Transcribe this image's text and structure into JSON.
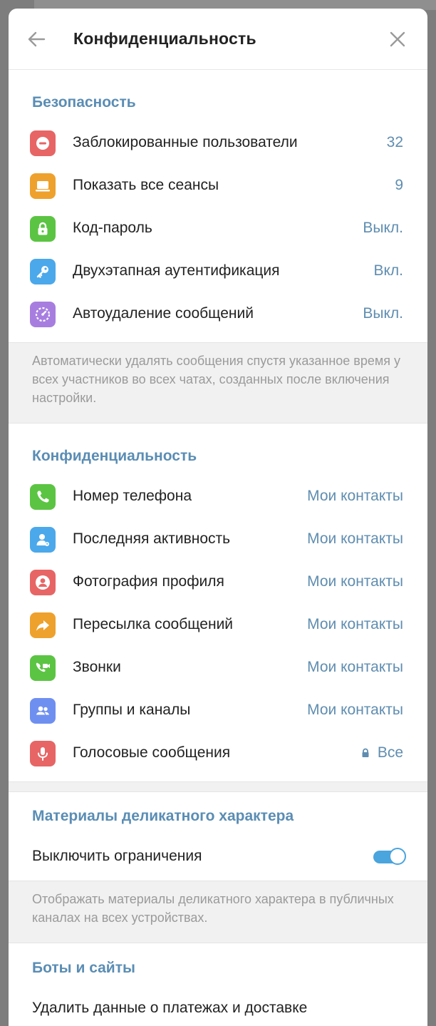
{
  "header": {
    "title": "Конфиденциальность"
  },
  "security": {
    "title": "Безопасность",
    "items": [
      {
        "label": "Заблокированные пользователи",
        "value": "32",
        "icon": "blocked-icon",
        "color": "#e76565"
      },
      {
        "label": "Показать все сеансы",
        "value": "9",
        "icon": "laptop-icon",
        "color": "#eea12c"
      },
      {
        "label": "Код-пароль",
        "value": "Выкл.",
        "icon": "lock-icon",
        "color": "#5cc443"
      },
      {
        "label": "Двухэтапная аутентификация",
        "value": "Вкл.",
        "icon": "key-icon",
        "color": "#4ba8ea"
      },
      {
        "label": "Автоудаление сообщений",
        "value": "Выкл.",
        "icon": "timer-icon",
        "color": "#a77ee0"
      }
    ],
    "hint": "Автоматически удалять сообщения спустя указанное время у всех участников во всех чатах, созданных после включения настройки."
  },
  "privacy": {
    "title": "Конфиденциальность",
    "items": [
      {
        "label": "Номер телефона",
        "value": "Мои контакты",
        "icon": "phone-icon",
        "color": "#5cc443"
      },
      {
        "label": "Последняя активность",
        "value": "Мои контакты",
        "icon": "last-seen-icon",
        "color": "#4ba8ea"
      },
      {
        "label": "Фотография профиля",
        "value": "Мои контакты",
        "icon": "profile-photo-icon",
        "color": "#e76565"
      },
      {
        "label": "Пересылка сообщений",
        "value": "Мои контакты",
        "icon": "forward-icon",
        "color": "#eea12c"
      },
      {
        "label": "Звонки",
        "value": "Мои контакты",
        "icon": "video-call-icon",
        "color": "#5cc443"
      },
      {
        "label": "Группы и каналы",
        "value": "Мои контакты",
        "icon": "groups-icon",
        "color": "#6f8ff0"
      },
      {
        "label": "Голосовые сообщения",
        "value": "Все",
        "icon": "microphone-icon",
        "color": "#e76565"
      }
    ]
  },
  "sensitive": {
    "title": "Материалы деликатного характера",
    "toggle_label": "Выключить ограничения",
    "toggle_on": true,
    "hint": "Отображать материалы деликатного характера в публичных каналах на всех устройствах."
  },
  "bots": {
    "title": "Боты и сайты",
    "item_label": "Удалить данные о платежах и доставке"
  },
  "colors": {
    "accent": "#4aa4dd",
    "section_title": "#5a8db4"
  }
}
